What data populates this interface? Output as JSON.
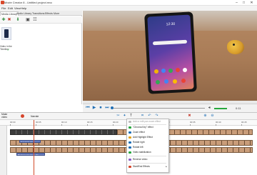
{
  "window": {
    "title": "Movie Creator 8 - Untitled project.mvc",
    "minimize": "–",
    "maximize": "□",
    "close": "✕"
  },
  "menu": [
    "File",
    "Edit",
    "View",
    "Help"
  ],
  "left_panel": {
    "tabs": [
      "Media Library",
      "Audio Library",
      "Transitions",
      "Effects",
      "More"
    ],
    "active_tab": "Media Library",
    "toolbar_icons": [
      "add-media-icon",
      "delete-icon",
      "import-icon",
      "filter-icon",
      "view-mode-icon"
    ],
    "media_item": {
      "caption_line1": "Video in the",
      "caption_line2": "Timeline",
      "check": "✔"
    }
  },
  "preview": {
    "clock": "12:30",
    "time_readout": "0:11"
  },
  "playback": {
    "controls": [
      "⏮",
      "▶",
      "⏹",
      "⏭"
    ],
    "volume_level": 0.7
  },
  "timeline_toolbar": {
    "make_video": "Make video",
    "narrate": "Narrate"
  },
  "ruler": {
    "labels": [
      "00:00",
      "00:05",
      "00:10",
      "00:15",
      "00:20",
      "00:25",
      "00:30",
      "00:35",
      "00:40",
      "00:45"
    ]
  },
  "tracks": {
    "text_clip_1": "Text track clip",
    "text_clip_2": "Background videos clip"
  },
  "context_menu": {
    "items": [
      "Add or edit pan zoom effect",
      "\"Chroma Key\" effect",
      "Zoom effect",
      "Add Highlight Effect",
      "Rotate right",
      "Rotate left",
      "Video stabilization",
      "Reverse video",
      "Start/End Effects"
    ]
  },
  "colors": {
    "accent": "#1f6fb5",
    "record": "#d6452b",
    "volume": "#27a83e",
    "playhead": "#d24a2a"
  }
}
